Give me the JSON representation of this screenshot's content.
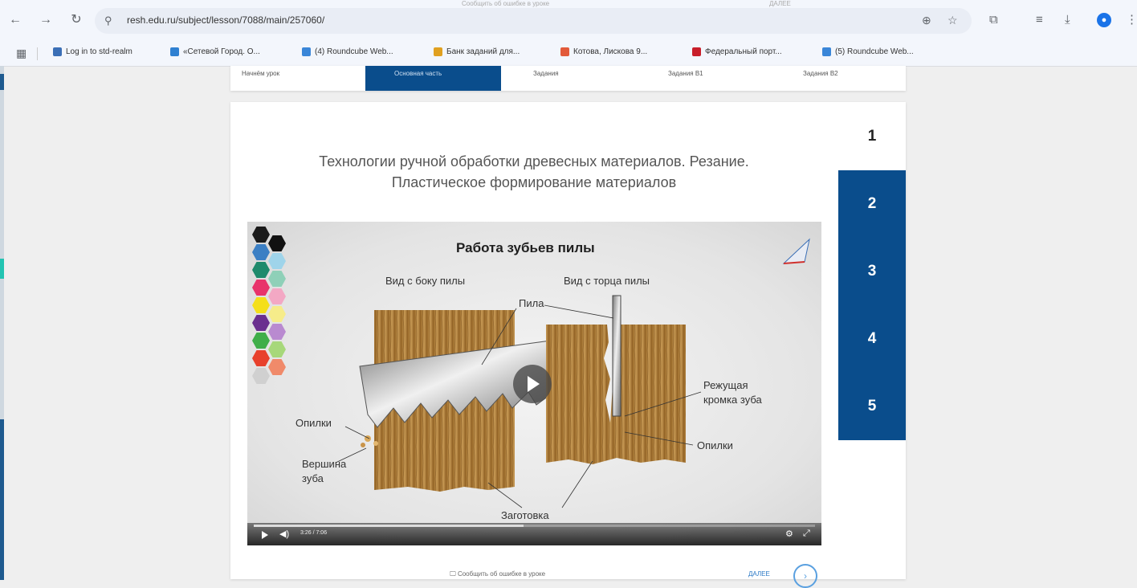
{
  "browser": {
    "url": "resh.edu.ru/subject/lesson/7088/main/257060/",
    "ghost_tooltip_1": "Сообщить об ошибке в уроке",
    "ghost_tooltip_2": "ДАЛЕЕ",
    "bookmarks": [
      {
        "label": "Log in to std-realm",
        "color": "#3b6fb6"
      },
      {
        "label": "«Сетевой Город. О...",
        "color": "#2f80d1"
      },
      {
        "label": "(4) Roundcube Web...",
        "color": "#3a86d8"
      },
      {
        "label": "Банк заданий для...",
        "color": "#e0a020"
      },
      {
        "label": "Котова, Лискова 9...",
        "color": "#e25a3a"
      },
      {
        "label": "Федеральный порт...",
        "color": "#c81e2a"
      },
      {
        "label": "(5) Roundcube Web...",
        "color": "#3a86d8"
      }
    ]
  },
  "tabs": [
    {
      "label": "Начнём урок",
      "active": false
    },
    {
      "label": "Основная часть",
      "active": true
    },
    {
      "label": "Задания",
      "active": false
    },
    {
      "label": "Задания В1",
      "active": false
    },
    {
      "label": "Задания В2",
      "active": false
    }
  ],
  "lesson": {
    "title_line1": "Технологии ручной обработки древесных материалов. Резание.",
    "title_line2": "Пластическое формирование материалов"
  },
  "steps": [
    "1",
    "2",
    "3",
    "4",
    "5"
  ],
  "video": {
    "title": "Работа зубьев пилы",
    "label_side": "Вид с боку пилы",
    "label_end": "Вид с торца пилы",
    "label_saw": "Пила",
    "label_edge_1": "Режущая",
    "label_edge_2": "кромка зуба",
    "label_sawdust_left": "Опилки",
    "label_sawdust_right": "Опилки",
    "label_tip_1": "Вершина",
    "label_tip_2": "зуба",
    "label_workpiece": "Заготовка",
    "time": "3:26 / 7:06",
    "progress": 0.48
  },
  "palette_colors": [
    "#1a1a1a",
    "#111111",
    "#3b7fc4",
    "#9fd4ea",
    "#1e8a6c",
    "#8fd0b8",
    "#e8336b",
    "#f3a8c4",
    "#f4df1a",
    "#f6ec8a",
    "#6a2f8f",
    "#b98ad0",
    "#3fae49",
    "#a7d87a",
    "#e8412c",
    "#f08a6a",
    "#d0d0d0"
  ],
  "footer": {
    "report_label": "Сообщить об ошибке в уроке",
    "next_label": "ДАЛЕЕ",
    "next_icon": "arrow-right-circle-icon"
  }
}
